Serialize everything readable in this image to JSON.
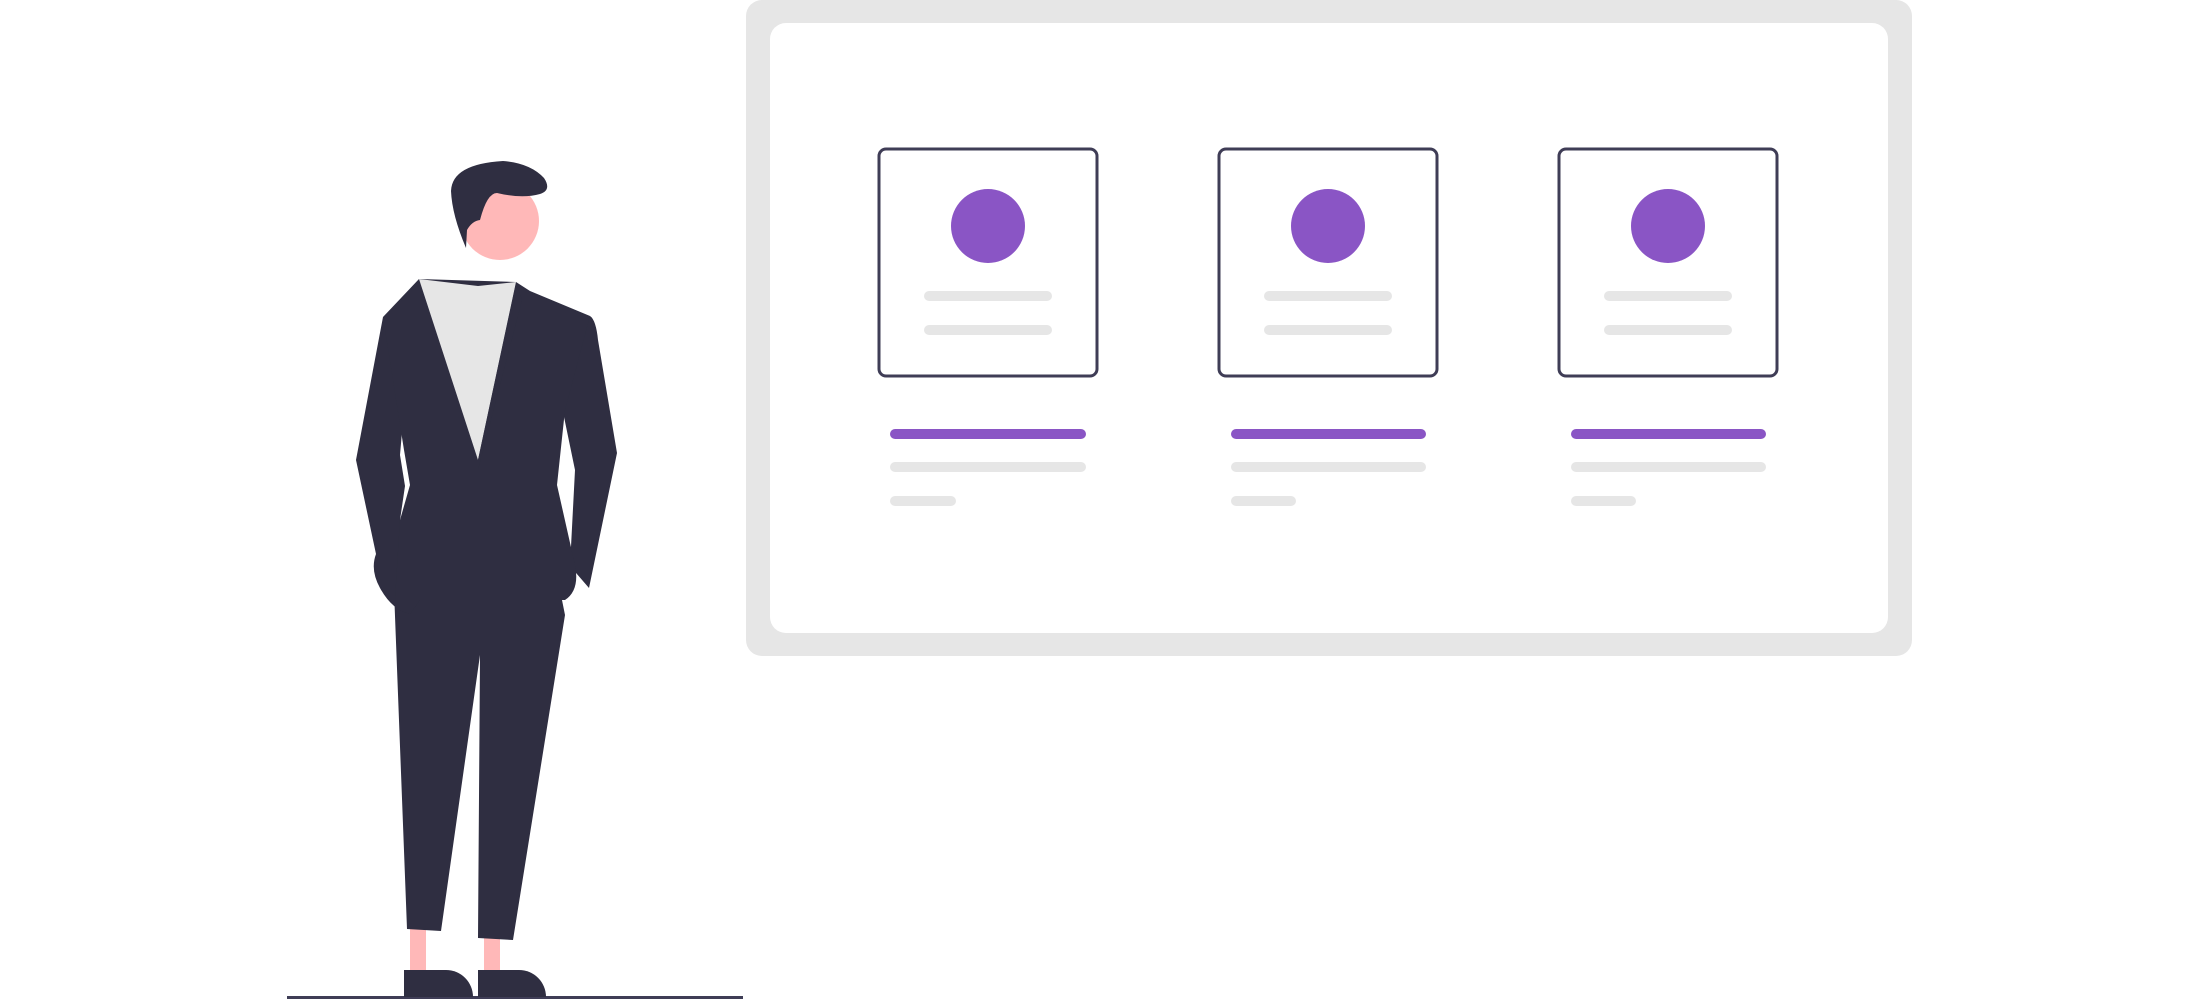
{
  "colors": {
    "board_frame": "#e6e6e6",
    "board_surface": "#ffffff",
    "card_border": "#3f3d56",
    "accent": "#8a55c5",
    "placeholder_line": "#e6e6e6",
    "suit": "#2f2e41",
    "shirt": "#e6e6e6",
    "skin": "#ffb8b8",
    "floor": "#3f3d56"
  },
  "icons": {
    "avatar": "avatar-icon",
    "person": "person-illustration"
  },
  "profile_cards": [
    {
      "id": "card-1"
    },
    {
      "id": "card-2"
    },
    {
      "id": "card-3"
    }
  ]
}
